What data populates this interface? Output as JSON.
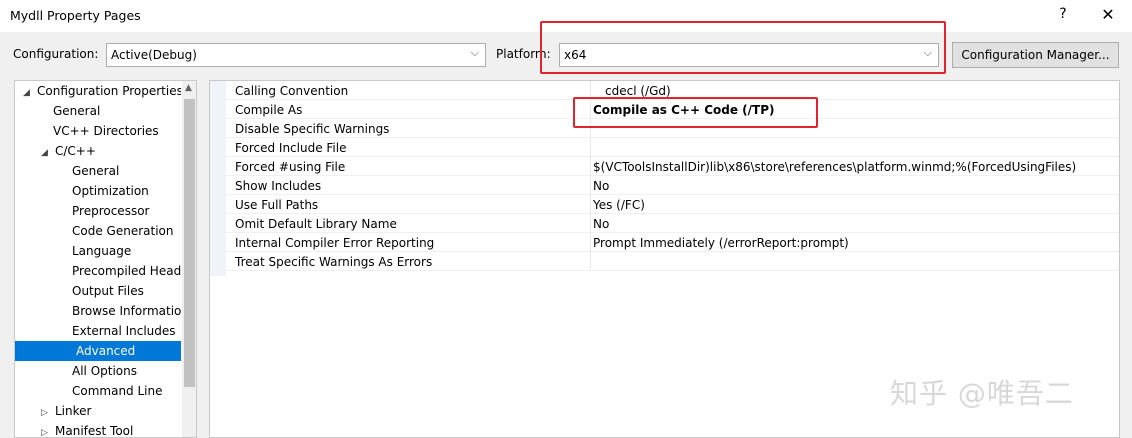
{
  "window": {
    "title": "Mydll Property Pages",
    "help": "?",
    "close": "✕"
  },
  "toolbar": {
    "configuration_label": "Configuration:",
    "configuration_value": "Active(Debug)",
    "platform_label": "Platform:",
    "platform_value": "x64",
    "config_manager_label": "Configuration Manager..."
  },
  "tree": {
    "items": [
      {
        "label": "Configuration Properties",
        "twisty": "◢"
      },
      {
        "label": "General"
      },
      {
        "label": "VC++ Directories"
      },
      {
        "label": "C/C++",
        "twisty": "◢"
      },
      {
        "label": "General"
      },
      {
        "label": "Optimization"
      },
      {
        "label": "Preprocessor"
      },
      {
        "label": "Code Generation"
      },
      {
        "label": "Language"
      },
      {
        "label": "Precompiled Headers"
      },
      {
        "label": "Output Files"
      },
      {
        "label": "Browse Information"
      },
      {
        "label": "External Includes"
      },
      {
        "label": "Advanced",
        "selected": true
      },
      {
        "label": "All Options"
      },
      {
        "label": "Command Line"
      },
      {
        "label": "Linker",
        "twisty": "▷"
      },
      {
        "label": "Manifest Tool",
        "twisty": "▷"
      }
    ]
  },
  "properties": [
    {
      "name": "Calling Convention",
      "value": "__cdecl (/Gd)"
    },
    {
      "name": "Compile As",
      "value": "Compile as C++ Code (/TP)",
      "bold": true
    },
    {
      "name": "Disable Specific Warnings",
      "value": ""
    },
    {
      "name": "Forced Include File",
      "value": ""
    },
    {
      "name": "Forced #using File",
      "value": "$(VCToolsInstallDir)lib\\x86\\store\\references\\platform.winmd;%(ForcedUsingFiles)"
    },
    {
      "name": "Show Includes",
      "value": "No"
    },
    {
      "name": "Use Full Paths",
      "value": "Yes (/FC)"
    },
    {
      "name": "Omit Default Library Name",
      "value": "No"
    },
    {
      "name": "Internal Compiler Error Reporting",
      "value": "Prompt Immediately (/errorReport:prompt)"
    },
    {
      "name": "Treat Specific Warnings As Errors",
      "value": ""
    }
  ],
  "watermark": "知乎 @唯吾二",
  "colors": {
    "selection": "#0078d7",
    "highlight_box": "#e0262d"
  }
}
